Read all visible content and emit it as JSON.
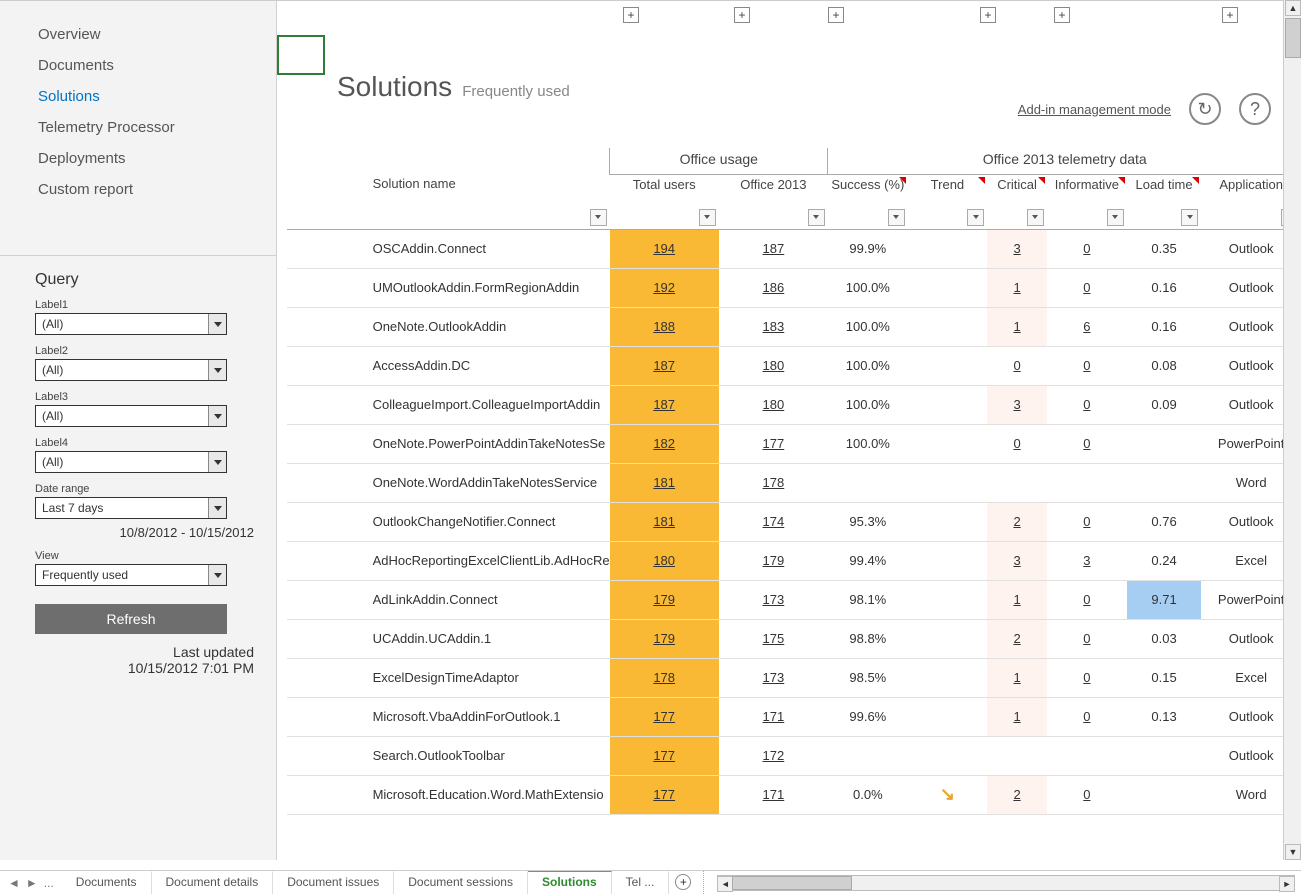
{
  "nav": {
    "items": [
      {
        "label": "Overview",
        "selected": false
      },
      {
        "label": "Documents",
        "selected": false
      },
      {
        "label": "Solutions",
        "selected": true
      },
      {
        "label": "Telemetry Processor",
        "selected": false
      },
      {
        "label": "Deployments",
        "selected": false
      },
      {
        "label": "Custom report",
        "selected": false
      }
    ]
  },
  "query": {
    "title": "Query",
    "labels": [
      "Label1",
      "Label2",
      "Label3",
      "Label4"
    ],
    "values": [
      "(All)",
      "(All)",
      "(All)",
      "(All)"
    ],
    "date_range_label": "Date range",
    "date_range_value": "Last 7 days",
    "date_range_text": "10/8/2012 - 10/15/2012",
    "view_label": "View",
    "view_value": "Frequently used",
    "refresh_label": "Refresh",
    "last_updated_label": "Last updated",
    "last_updated_value": "10/15/2012 7:01 PM"
  },
  "page": {
    "title": "Solutions",
    "subtitle": "Frequently used",
    "mode_link": "Add-in management mode",
    "refresh_icon": "↻",
    "help_icon": "?"
  },
  "grid": {
    "group_headers": {
      "usage": "Office usage",
      "telemetry": "Office 2013 telemetry data"
    },
    "columns": [
      "Solution name",
      "Total users",
      "Office 2013",
      "Success (%)",
      "Trend",
      "Critical",
      "Informative",
      "Load time",
      "Application"
    ],
    "rows": [
      {
        "name": "OSCAddin.Connect",
        "total": "194",
        "o2013": "187",
        "success": "99.9%",
        "trend": "",
        "critical": "3",
        "informative": "0",
        "load": "0.35",
        "app": "Outlook"
      },
      {
        "name": "UMOutlookAddin.FormRegionAddin",
        "total": "192",
        "o2013": "186",
        "success": "100.0%",
        "trend": "",
        "critical": "1",
        "informative": "0",
        "load": "0.16",
        "app": "Outlook"
      },
      {
        "name": "OneNote.OutlookAddin",
        "total": "188",
        "o2013": "183",
        "success": "100.0%",
        "trend": "",
        "critical": "1",
        "informative": "6",
        "load": "0.16",
        "app": "Outlook"
      },
      {
        "name": "AccessAddin.DC",
        "total": "187",
        "o2013": "180",
        "success": "100.0%",
        "trend": "",
        "critical": "0",
        "informative": "0",
        "load": "0.08",
        "app": "Outlook"
      },
      {
        "name": "ColleagueImport.ColleagueImportAddin",
        "total": "187",
        "o2013": "180",
        "success": "100.0%",
        "trend": "",
        "critical": "3",
        "informative": "0",
        "load": "0.09",
        "app": "Outlook"
      },
      {
        "name": "OneNote.PowerPointAddinTakeNotesSe",
        "total": "182",
        "o2013": "177",
        "success": "100.0%",
        "trend": "",
        "critical": "0",
        "informative": "0",
        "load": "",
        "app": "PowerPoint"
      },
      {
        "name": "OneNote.WordAddinTakeNotesService",
        "total": "181",
        "o2013": "178",
        "success": "",
        "trend": "",
        "critical": "",
        "informative": "",
        "load": "",
        "app": "Word"
      },
      {
        "name": "OutlookChangeNotifier.Connect",
        "total": "181",
        "o2013": "174",
        "success": "95.3%",
        "trend": "",
        "critical": "2",
        "informative": "0",
        "load": "0.76",
        "app": "Outlook"
      },
      {
        "name": "AdHocReportingExcelClientLib.AdHocRe",
        "total": "180",
        "o2013": "179",
        "success": "99.4%",
        "trend": "",
        "critical": "3",
        "informative": "3",
        "load": "0.24",
        "app": "Excel"
      },
      {
        "name": "AdLinkAddin.Connect",
        "total": "179",
        "o2013": "173",
        "success": "98.1%",
        "trend": "",
        "critical": "1",
        "informative": "0",
        "load": "9.71",
        "app": "PowerPoint",
        "slow": true
      },
      {
        "name": "UCAddin.UCAddin.1",
        "total": "179",
        "o2013": "175",
        "success": "98.8%",
        "trend": "",
        "critical": "2",
        "informative": "0",
        "load": "0.03",
        "app": "Outlook"
      },
      {
        "name": "ExcelDesignTimeAdaptor",
        "total": "178",
        "o2013": "173",
        "success": "98.5%",
        "trend": "",
        "critical": "1",
        "informative": "0",
        "load": "0.15",
        "app": "Excel"
      },
      {
        "name": "Microsoft.VbaAddinForOutlook.1",
        "total": "177",
        "o2013": "171",
        "success": "99.6%",
        "trend": "",
        "critical": "1",
        "informative": "0",
        "load": "0.13",
        "app": "Outlook"
      },
      {
        "name": "Search.OutlookToolbar",
        "total": "177",
        "o2013": "172",
        "success": "",
        "trend": "",
        "critical": "",
        "informative": "",
        "load": "",
        "app": "Outlook"
      },
      {
        "name": "Microsoft.Education.Word.MathExtensio",
        "total": "177",
        "o2013": "171",
        "success": "0.0%",
        "trend": "↘",
        "critical": "2",
        "informative": "0",
        "load": "",
        "app": "Word"
      }
    ]
  },
  "tabs": {
    "items": [
      "Documents",
      "Document details",
      "Document issues",
      "Document sessions",
      "Solutions",
      "Tel ..."
    ],
    "active": "Solutions",
    "ellipsis": "...",
    "plus": "+"
  },
  "expand_plus": "+"
}
